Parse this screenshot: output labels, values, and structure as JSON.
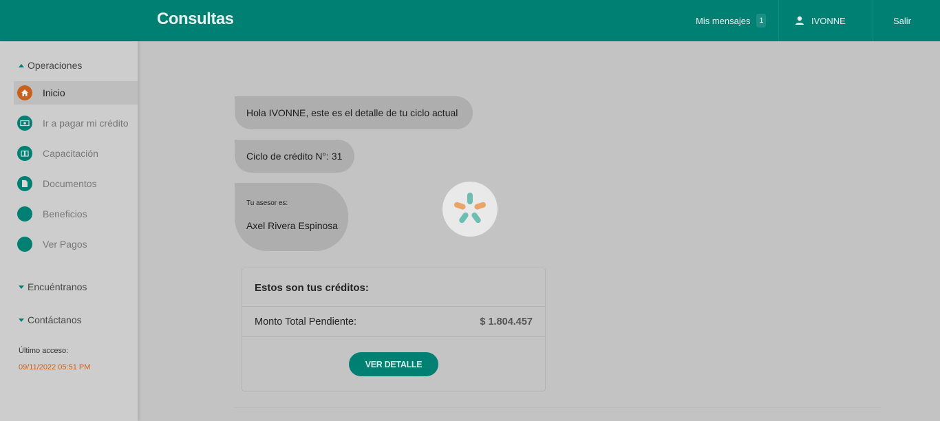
{
  "header": {
    "title": "Consultas",
    "messages_label": "Mis mensajes",
    "messages_count": "1",
    "user_name": "IVONNE",
    "logout_label": "Salir"
  },
  "sidebar": {
    "operations_label": "Operaciones",
    "items": [
      {
        "label": "Inicio",
        "icon": "home-icon"
      },
      {
        "label": "Ir a pagar mi crédito",
        "icon": "money-icon"
      },
      {
        "label": "Capacitación",
        "icon": "book-icon"
      },
      {
        "label": "Documentos",
        "icon": "document-icon"
      },
      {
        "label": "Beneficios",
        "icon": "circle-icon"
      },
      {
        "label": "Ver Pagos",
        "icon": "circle-icon"
      }
    ],
    "find_us_label": "Encuéntranos",
    "contact_label": "Contáctanos",
    "last_access_label": "Último acceso:",
    "last_access_value": "09/11/2022 05:51 PM"
  },
  "chat": {
    "greeting": "Hola IVONNE, este es el detalle de tu ciclo actual",
    "cycle": "Ciclo de crédito N°: 31",
    "advisor_label": "Tu asesor es:",
    "advisor_name": "Axel Rivera Espinosa"
  },
  "credits": {
    "title": "Estos son tus créditos:",
    "total_label": "Monto Total Pendiente:",
    "total_value": "$ 1.804.457",
    "button_label": "VER DETALLE"
  },
  "colors": {
    "primary": "#007f73",
    "accent": "#c9611c",
    "spinner_orange": "#e8a46a",
    "spinner_teal": "#6dbdb1"
  }
}
